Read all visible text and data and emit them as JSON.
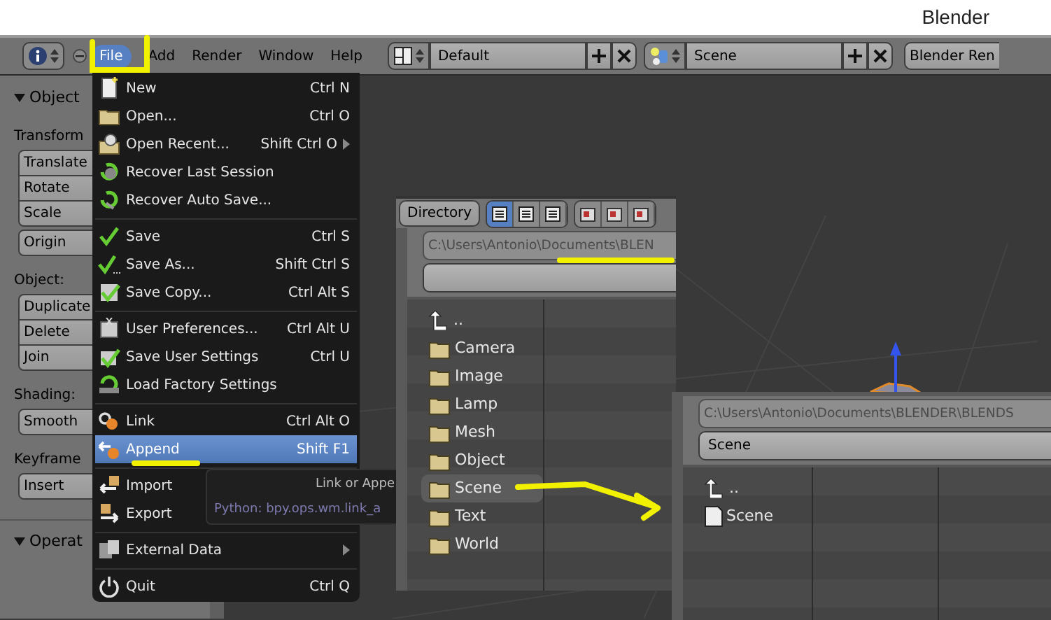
{
  "window": {
    "title": "Blender"
  },
  "header": {
    "menus": [
      {
        "label": "File",
        "selected": true
      },
      {
        "label": "Add",
        "selected": false
      },
      {
        "label": "Render",
        "selected": false
      },
      {
        "label": "Window",
        "selected": false
      },
      {
        "label": "Help",
        "selected": false
      }
    ],
    "layout": {
      "value": "Default"
    },
    "scene": {
      "value": "Scene"
    },
    "render_engine": "Blender Ren"
  },
  "tool_shelf": {
    "panels": [
      {
        "title": "Object",
        "expanded": true,
        "rows": [
          {
            "kind": "label",
            "text": "Transform"
          },
          {
            "kind": "buttons",
            "items": [
              "Translate",
              "Rotate",
              "Scale"
            ]
          },
          {
            "kind": "buttons",
            "items": [
              "Origin"
            ]
          },
          {
            "kind": "label",
            "text": "Object:"
          },
          {
            "kind": "buttons",
            "items": [
              "Duplicate",
              "Delete",
              "Join"
            ]
          },
          {
            "kind": "label",
            "text": "Shading:"
          },
          {
            "kind": "buttons",
            "items": [
              "Smooth"
            ]
          },
          {
            "kind": "label",
            "text": "Keyframe"
          },
          {
            "kind": "buttons",
            "items": [
              "Insert"
            ]
          }
        ]
      },
      {
        "title": "Operat",
        "expanded": true
      }
    ]
  },
  "file_menu": {
    "items": [
      {
        "kind": "item",
        "label": "New",
        "shortcut": "Ctrl N",
        "submenu": false,
        "selected": false
      },
      {
        "kind": "item",
        "label": "Open...",
        "shortcut": "Ctrl O",
        "submenu": false,
        "selected": false
      },
      {
        "kind": "item",
        "label": "Open Recent...",
        "shortcut": "Shift Ctrl O",
        "submenu": true,
        "selected": false
      },
      {
        "kind": "item",
        "label": "Recover Last Session",
        "submenu": false,
        "selected": false
      },
      {
        "kind": "item",
        "label": "Recover Auto Save...",
        "submenu": false,
        "selected": false
      },
      {
        "kind": "separator"
      },
      {
        "kind": "item",
        "label": "Save",
        "shortcut": "Ctrl S",
        "submenu": false,
        "selected": false
      },
      {
        "kind": "item",
        "label": "Save As...",
        "shortcut": "Shift Ctrl S",
        "submenu": false,
        "selected": false
      },
      {
        "kind": "item",
        "label": "Save Copy...",
        "shortcut": "Ctrl Alt S",
        "submenu": false,
        "selected": false
      },
      {
        "kind": "separator"
      },
      {
        "kind": "item",
        "label": "User Preferences...",
        "shortcut": "Ctrl Alt U",
        "submenu": false,
        "selected": false
      },
      {
        "kind": "item",
        "label": "Save User Settings",
        "shortcut": "Ctrl U",
        "submenu": false,
        "selected": false
      },
      {
        "kind": "item",
        "label": "Load Factory Settings",
        "submenu": false,
        "selected": false
      },
      {
        "kind": "separator"
      },
      {
        "kind": "item",
        "label": "Link",
        "shortcut": "Ctrl Alt O",
        "submenu": false,
        "selected": false
      },
      {
        "kind": "item",
        "label": "Append",
        "shortcut": "Shift F1",
        "submenu": false,
        "selected": true
      },
      {
        "kind": "separator"
      },
      {
        "kind": "item",
        "label": "Import",
        "submenu": false,
        "selected": false
      },
      {
        "kind": "item",
        "label": "Export",
        "submenu": false,
        "selected": false
      },
      {
        "kind": "separator"
      },
      {
        "kind": "item",
        "label": "External Data",
        "submenu": true,
        "selected": false
      },
      {
        "kind": "separator"
      },
      {
        "kind": "item",
        "label": "Quit",
        "shortcut": "Ctrl Q",
        "submenu": false,
        "selected": false
      }
    ]
  },
  "tooltip": {
    "title": "Link or Appe",
    "python": "Python: bpy.ops.wm.link_a"
  },
  "file_browser_1": {
    "directory_button": "Directory",
    "path": "C:\\Users\\Antonio\\Documents\\BLEN",
    "entries": [
      {
        "kind": "parent",
        "label": "..",
        "selected": false
      },
      {
        "kind": "folder",
        "label": "Camera",
        "selected": false
      },
      {
        "kind": "folder",
        "label": "Image",
        "selected": false
      },
      {
        "kind": "folder",
        "label": "Lamp",
        "selected": false
      },
      {
        "kind": "folder",
        "label": "Mesh",
        "selected": false
      },
      {
        "kind": "folder",
        "label": "Object",
        "selected": false
      },
      {
        "kind": "folder",
        "label": "Scene",
        "selected": true
      },
      {
        "kind": "folder",
        "label": "Text",
        "selected": false
      },
      {
        "kind": "folder",
        "label": "World",
        "selected": false
      }
    ]
  },
  "file_browser_2": {
    "path": "C:\\Users\\Antonio\\Documents\\BLENDER\\BLENDS",
    "filename": "Scene",
    "entries": [
      {
        "kind": "parent",
        "label": "..",
        "selected": false
      },
      {
        "kind": "file",
        "label": "Scene",
        "selected": false
      }
    ]
  }
}
